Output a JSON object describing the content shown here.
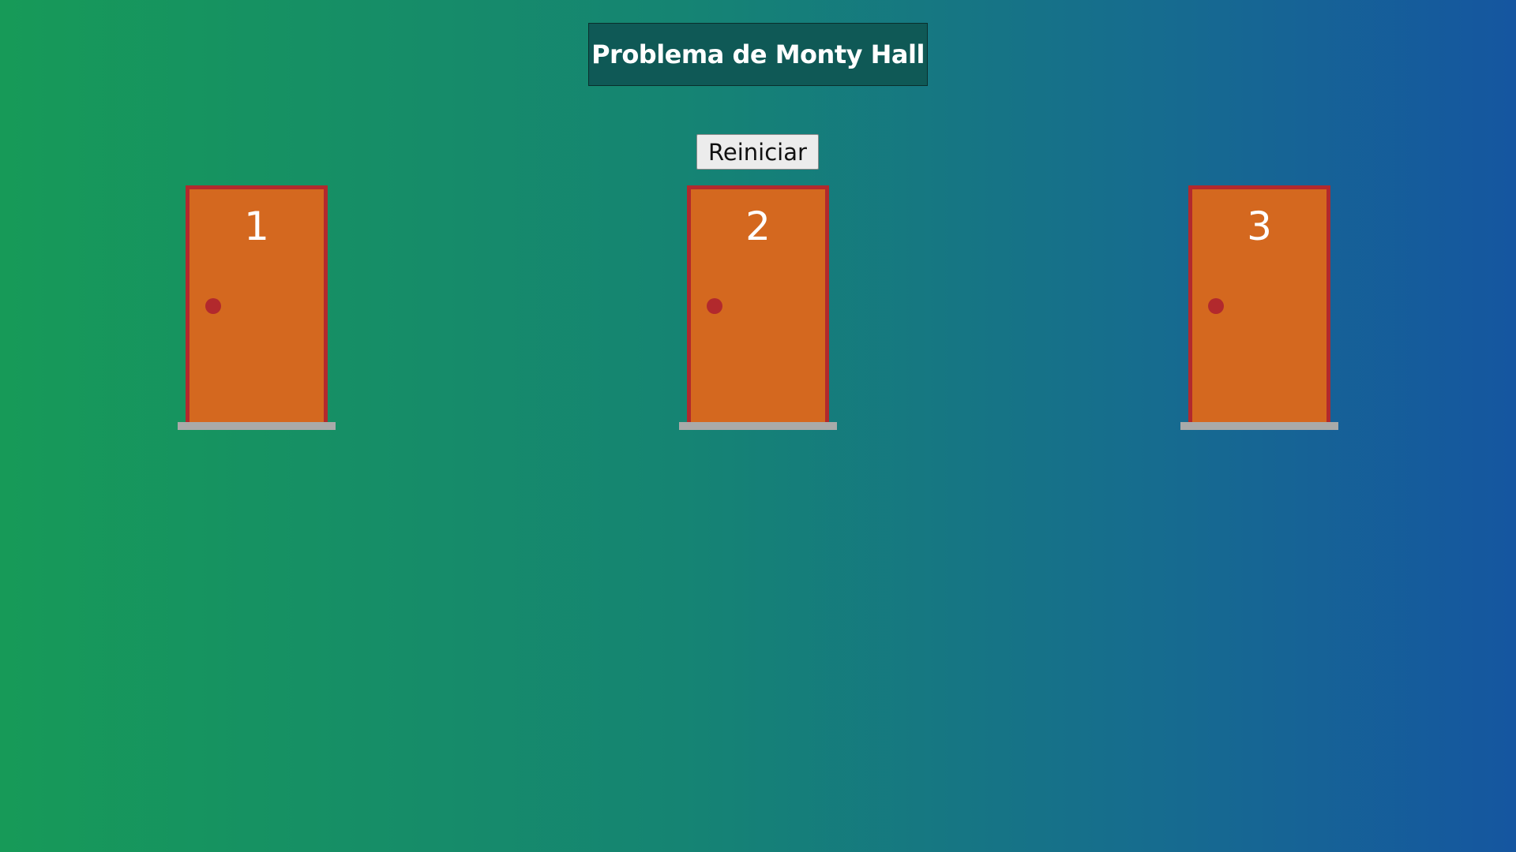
{
  "header": {
    "title": "Problema de Monty Hall"
  },
  "controls": {
    "reset_label": "Reiniciar"
  },
  "doors": [
    {
      "number": "1"
    },
    {
      "number": "2"
    },
    {
      "number": "3"
    }
  ],
  "colors": {
    "door_fill": "#d4681f",
    "door_frame": "#b2292d",
    "door_knob": "#b2292d",
    "door_sill": "#a9aaa9",
    "title_background": "#0f5956",
    "background_left": "#179a58",
    "background_right": "#1556a0"
  },
  "icons": {
    "door": "door-icon",
    "knob": "door-knob-icon"
  }
}
